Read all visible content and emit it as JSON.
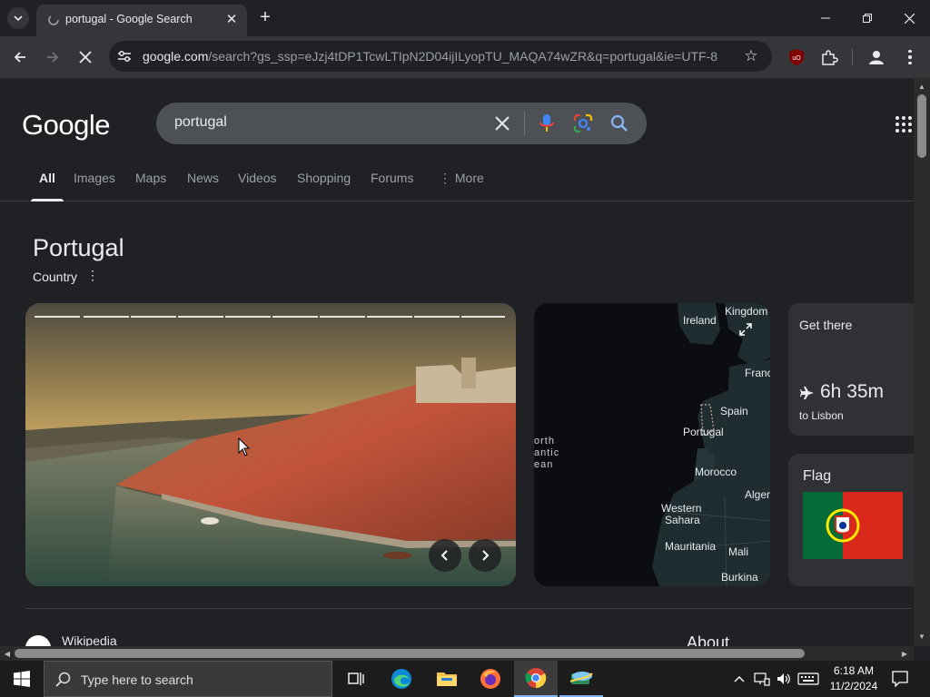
{
  "browser": {
    "tab_title": "portugal - Google Search",
    "url_host": "google.com",
    "url_rest": "/search?gs_ssp=eJzj4tDP1TcwLTIpN2D04ijILyopTU_MAQA74wZR&q=portugal&ie=UTF-8"
  },
  "search": {
    "logo": "Google",
    "query": "portugal",
    "tabs": [
      {
        "label": "All"
      },
      {
        "label": "Images"
      },
      {
        "label": "Maps"
      },
      {
        "label": "News"
      },
      {
        "label": "Videos"
      },
      {
        "label": "Shopping"
      },
      {
        "label": "Forums"
      },
      {
        "label": "More"
      }
    ]
  },
  "knowledge_panel": {
    "title": "Portugal",
    "subtitle": "Country",
    "map_labels": {
      "kingdom": "Kingdom",
      "ireland": "Ireland",
      "france": "Franc",
      "spain": "Spain",
      "portugal": "Portugal",
      "north_atlantic": "orth",
      "atlantic": "antic",
      "ocean": "ean",
      "morocco": "Morocco",
      "algeria": "Alger",
      "western_sahara_1": "Western",
      "western_sahara_2": "Sahara",
      "mauritania": "Mauritania",
      "mali": "Mali",
      "burkina": "Burkina"
    },
    "get_there": {
      "heading": "Get there",
      "duration": "6h 35m",
      "destination": "to Lisbon"
    },
    "flag": {
      "heading": "Flag",
      "green": "#046a38",
      "red": "#da291c"
    }
  },
  "results": {
    "first_source": "Wikipedia",
    "about_heading": "About"
  },
  "taskbar": {
    "search_placeholder": "Type here to search",
    "time": "6:18 AM",
    "date": "11/2/2024"
  },
  "colors": {
    "page_bg": "#202124",
    "toolbar_bg": "#35363a",
    "searchbox_bg": "#4d5156"
  }
}
